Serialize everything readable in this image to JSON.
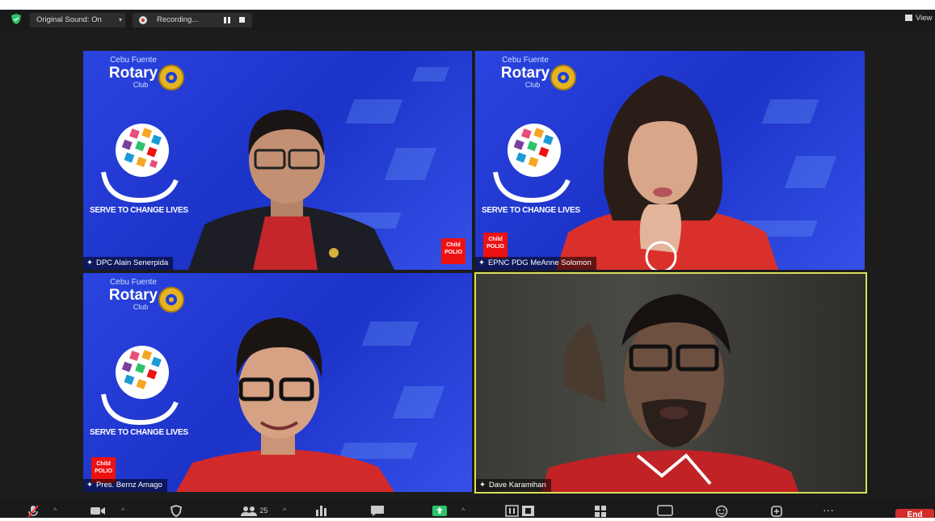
{
  "topbar": {
    "original_sound": "Original Sound: On",
    "recording": "Recording...",
    "view": "View"
  },
  "club": {
    "line1": "Cebu Fuente",
    "line2": "Rotary",
    "line3": "Club",
    "slogan": "SERVE TO CHANGE LIVES",
    "badge_line1": "Child",
    "badge_line2": "POLIO"
  },
  "participants": [
    {
      "name": "DPC Alain Senerpida"
    },
    {
      "name": "EPNC PDG MeAnne Solomon"
    },
    {
      "name": "Pres. Bernz Amago"
    },
    {
      "name": "Dave Karamihan"
    }
  ],
  "toolbar": {
    "participants_count": "25",
    "end_label": "End",
    "more": "···"
  },
  "colors": {
    "accent": "#2d8cff",
    "share_green": "#2cc36b",
    "end_red": "#d12d2d",
    "active_speaker": "#d6e05a",
    "rotary_blue": "#1f3fd8"
  }
}
